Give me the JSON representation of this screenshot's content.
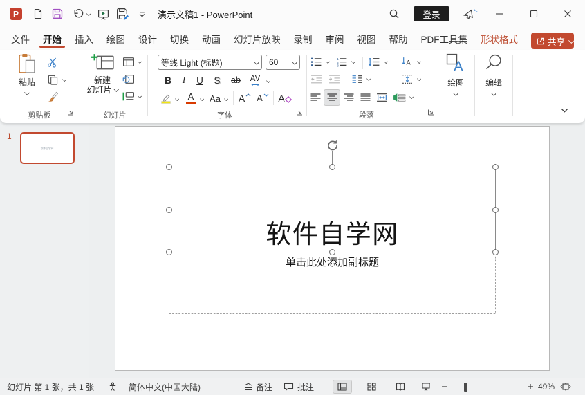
{
  "colors": {
    "accent": "#c2492f",
    "login_bg": "#1e1e1e"
  },
  "titlebar": {
    "title": "演示文稿1 - PowerPoint",
    "login_label": "登录"
  },
  "tabs": {
    "items": [
      {
        "label": "文件"
      },
      {
        "label": "开始",
        "active": true
      },
      {
        "label": "插入"
      },
      {
        "label": "绘图"
      },
      {
        "label": "设计"
      },
      {
        "label": "切换"
      },
      {
        "label": "动画"
      },
      {
        "label": "幻灯片放映"
      },
      {
        "label": "录制"
      },
      {
        "label": "审阅"
      },
      {
        "label": "视图"
      },
      {
        "label": "帮助"
      },
      {
        "label": "PDF工具集"
      },
      {
        "label": "形状格式",
        "contextual": true
      }
    ],
    "share_label": "共享"
  },
  "ribbon": {
    "clipboard": {
      "group_label": "剪贴板",
      "paste_label": "粘贴"
    },
    "slides": {
      "group_label": "幻灯片",
      "new_slide_line1": "新建",
      "new_slide_line2": "幻灯片"
    },
    "font": {
      "group_label": "字体",
      "font_name": "等线 Light (标题)",
      "font_size": "60",
      "bold": "B",
      "italic": "I",
      "underline": "U",
      "shadow": "S",
      "strikethrough": "ab",
      "char_spacing": "AV",
      "change_case": "Aa"
    },
    "paragraph": {
      "group_label": "段落"
    },
    "drawing": {
      "button_label": "绘图"
    },
    "editing": {
      "button_label": "编辑"
    }
  },
  "slides_panel": {
    "slide_number": "1",
    "thumbnail_title": "软件自学网"
  },
  "editor": {
    "title_text": "软件自学网",
    "subtitle_placeholder": "单击此处添加副标题"
  },
  "statusbar": {
    "slide_info": "幻灯片 第 1 张，共 1 张",
    "language": "简体中文(中国大陆)",
    "notes_label": "备注",
    "comments_label": "批注",
    "zoom_level": "49%"
  }
}
